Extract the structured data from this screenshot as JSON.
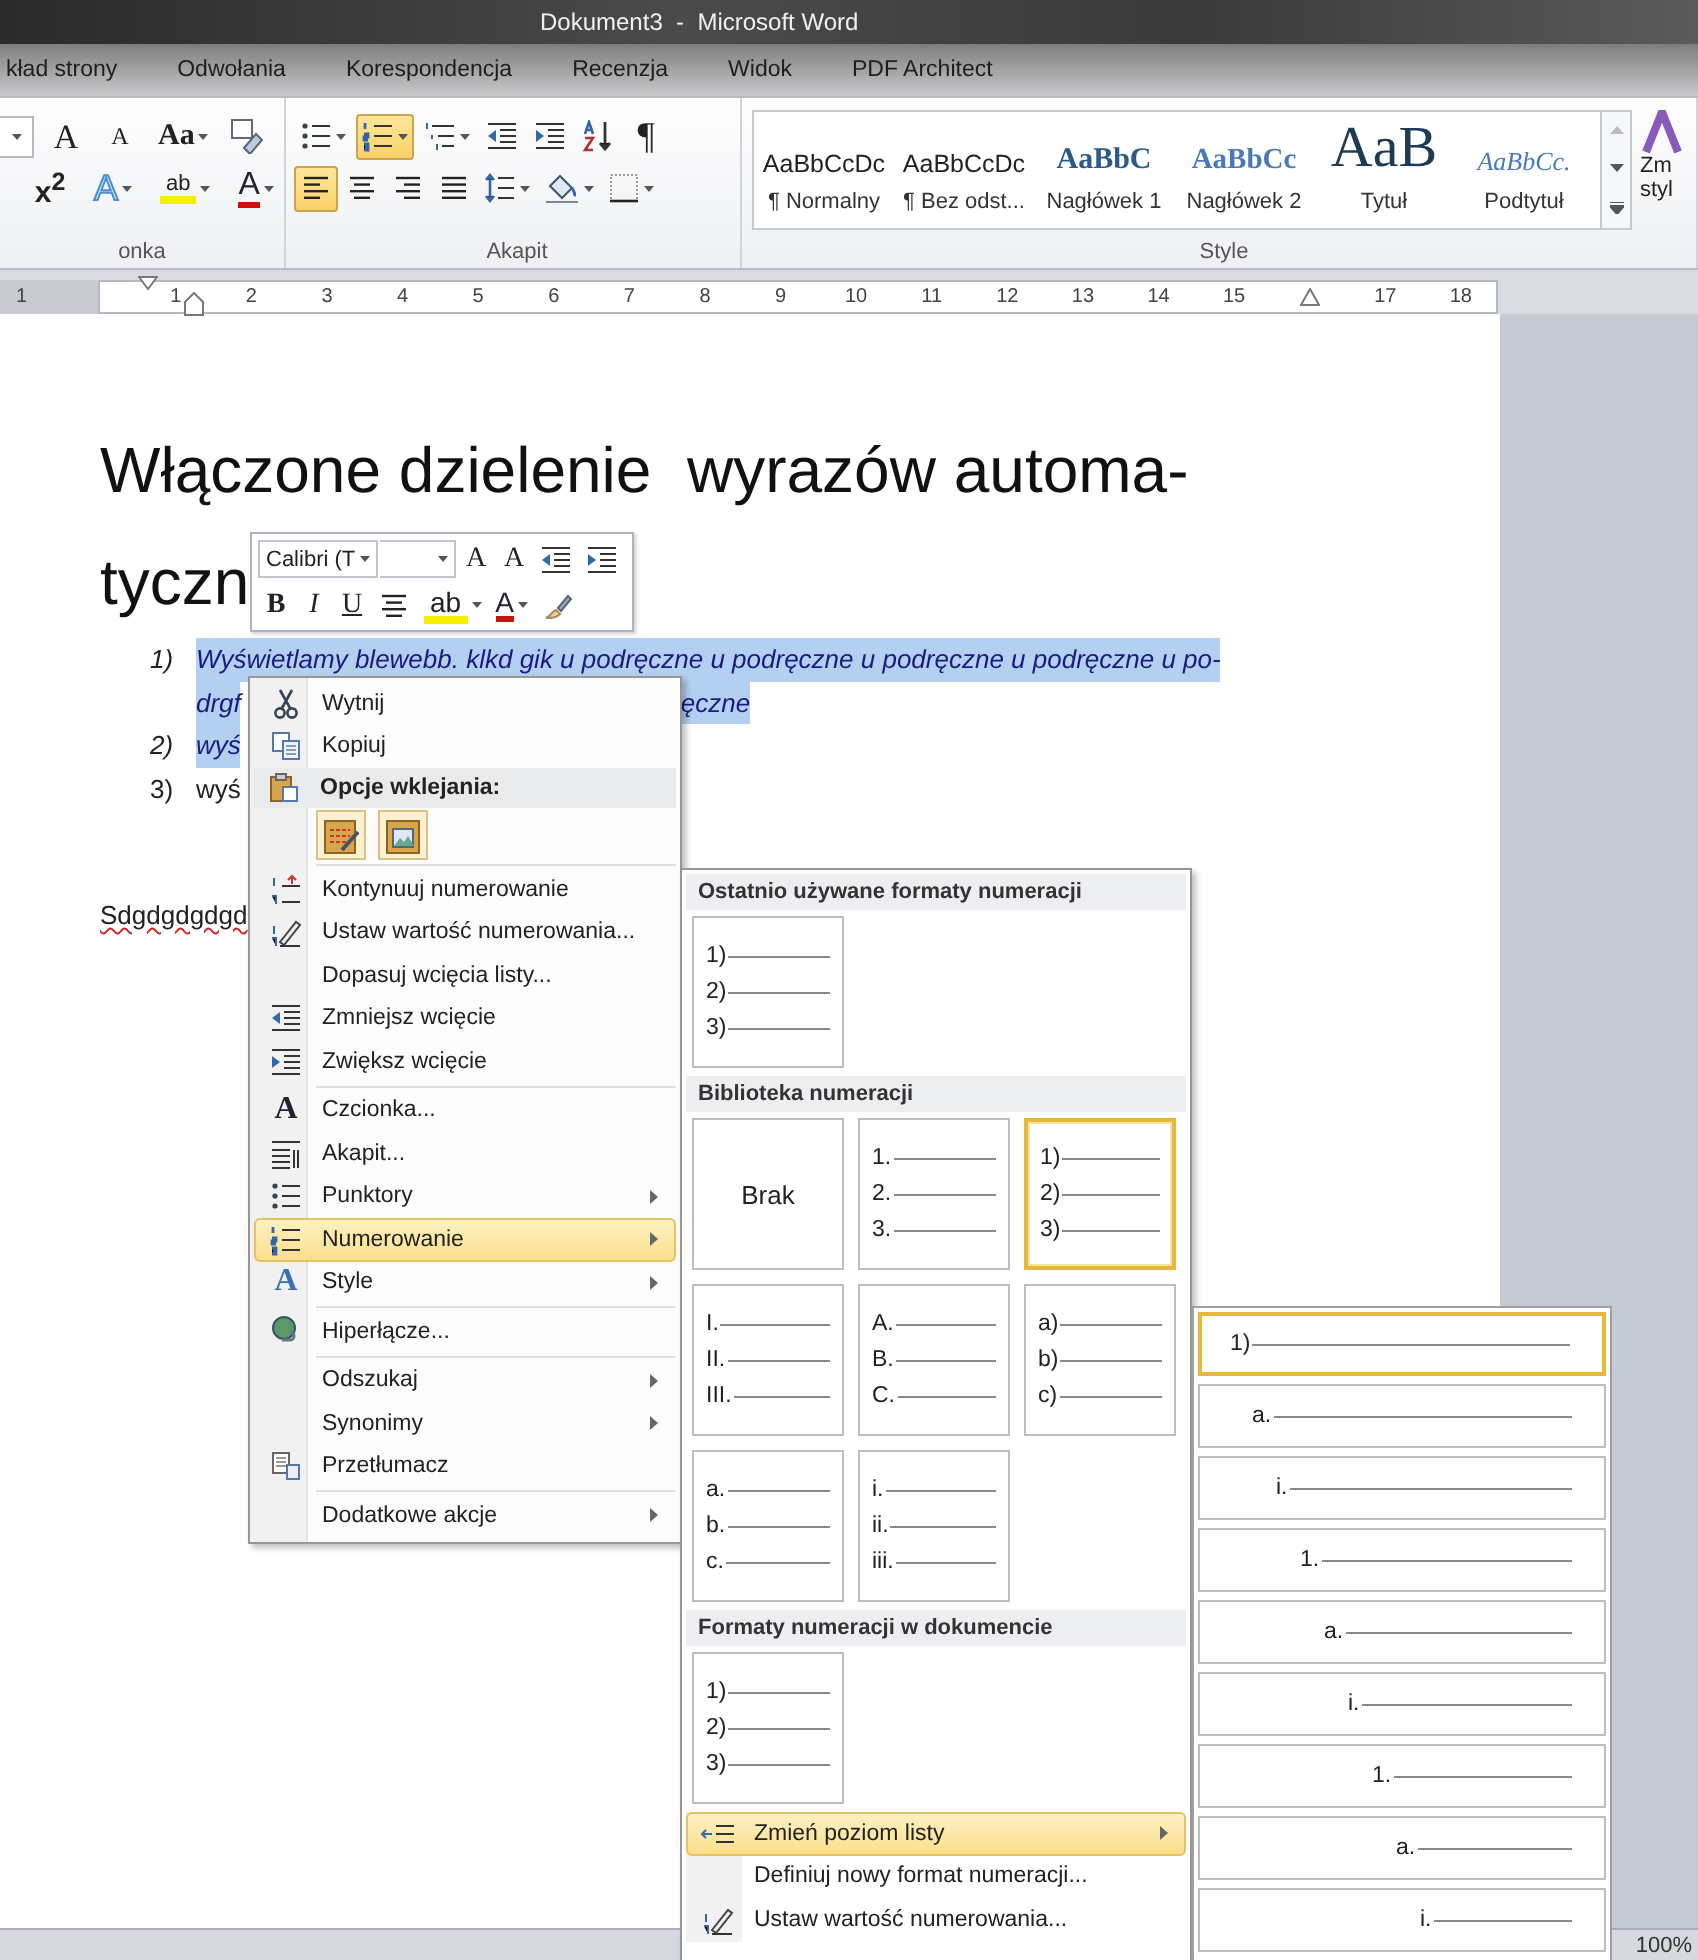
{
  "window": {
    "title": "Dokument3  -  Microsoft Word"
  },
  "tabs": [
    {
      "label": "kład strony",
      "selected": false
    },
    {
      "label": "Odwołania",
      "selected": false
    },
    {
      "label": "Korespondencja",
      "selected": false
    },
    {
      "label": "Recenzja",
      "selected": false
    },
    {
      "label": "Widok",
      "selected": false
    },
    {
      "label": "PDF Architect",
      "selected": false
    }
  ],
  "font_group": {
    "label": "onka",
    "row1": [
      {
        "kind": "size_dropdown"
      },
      {
        "kind": "grow",
        "glyph": "A"
      },
      {
        "kind": "shrink",
        "glyph": "A"
      },
      {
        "kind": "case",
        "glyph": "Aa"
      },
      {
        "kind": "clear"
      }
    ],
    "row2": [
      {
        "kind": "superscript",
        "glyph": "x$^{2}$"
      },
      {
        "kind": "effects",
        "glyph": "A"
      },
      {
        "kind": "highlight",
        "glyph": "ab"
      },
      {
        "kind": "color",
        "glyph": "A"
      }
    ]
  },
  "paragraph_group": {
    "label": "Akapit",
    "row1": [
      {
        "kind": "bullets",
        "selected": false
      },
      {
        "kind": "numbering",
        "selected": true
      },
      {
        "kind": "multilevel",
        "selected": false
      },
      {
        "kind": "outdent"
      },
      {
        "kind": "indent"
      },
      {
        "kind": "sort"
      },
      {
        "kind": "pilcrow",
        "glyph": "¶",
        "selected": false
      }
    ],
    "row2": [
      {
        "kind": "left",
        "selected": true
      },
      {
        "kind": "center",
        "selected": false
      },
      {
        "kind": "right",
        "selected": false
      },
      {
        "kind": "justify",
        "selected": false
      },
      {
        "kind": "spacing"
      },
      {
        "kind": "shading"
      },
      {
        "kind": "borders"
      }
    ]
  },
  "styles_group": {
    "label": "Style",
    "styles": [
      {
        "kind": "body",
        "sample": "AaBbCcDc",
        "label": "¶ Normalny"
      },
      {
        "kind": "body",
        "sample": "AaBbCcDc",
        "label": "¶ Bez odst..."
      },
      {
        "kind": "heading1",
        "sample": "AaBbC",
        "label": "Nagłówek 1"
      },
      {
        "kind": "heading2",
        "sample": "AaBbCc",
        "label": "Nagłówek 2"
      },
      {
        "kind": "title",
        "sample": "AaB",
        "label": "Tytuł"
      },
      {
        "kind": "subtitle",
        "sample": "AaBbCc.",
        "label": "Podtytuł"
      }
    ],
    "change_styles": [
      "Zm",
      "styl"
    ]
  },
  "ruler": {
    "left_labels": [
      "1"
    ],
    "labels": [
      "1",
      "2",
      "3",
      "4",
      "5",
      "6",
      "7",
      "8",
      "9",
      "10",
      "11",
      "12",
      "13",
      "14",
      "15",
      "17",
      "18"
    ]
  },
  "document": {
    "heading_lines": [
      "Włączone dzielenie  wyrazów automa-",
      "tyczn"
    ],
    "list": [
      {
        "number": "1)",
        "italic": true,
        "selected": true,
        "lines": [
          [
            "Wyświetlamy blewebb. klkd gik u podręczne u podręczne u podręczne u podręczne u po-"
          ],
          [
            "drgf",
            "ęczne"
          ]
        ]
      },
      {
        "number": "2)",
        "italic": true,
        "selected": true,
        "lines": [
          [
            "wyś"
          ]
        ]
      },
      {
        "number": "3)",
        "italic": false,
        "selected": false,
        "lines": [
          [
            "wyś"
          ]
        ]
      }
    ],
    "paragraph": "Sdgdgdgdgd"
  },
  "mini_toolbar": {
    "row1": [
      {
        "kind": "font_field",
        "value": "Calibri (T"
      },
      {
        "kind": "size_field"
      },
      {
        "kind": "grow",
        "glyph": "A"
      },
      {
        "kind": "shrink",
        "glyph": "A"
      },
      {
        "kind": "outdent"
      },
      {
        "kind": "indent"
      }
    ],
    "row2": [
      {
        "kind": "bold",
        "glyph": "B"
      },
      {
        "kind": "italic",
        "glyph": "I"
      },
      {
        "kind": "underline",
        "glyph": "U"
      },
      {
        "kind": "center",
        "selected": false
      },
      {
        "kind": "highlight",
        "glyph": "ab"
      },
      {
        "kind": "color",
        "glyph": "A"
      },
      {
        "kind": "painter"
      }
    ]
  },
  "context_menu": [
    {
      "kind": "item",
      "label": "Wytnij",
      "submenu": false,
      "selected": false
    },
    {
      "kind": "item",
      "label": "Kopiuj",
      "submenu": false,
      "selected": false
    },
    {
      "kind": "header",
      "label": "Opcje wklejania:"
    },
    {
      "kind": "paste_options"
    },
    {
      "kind": "separator"
    },
    {
      "kind": "item",
      "label": "Kontynuuj numerowanie",
      "submenu": false,
      "selected": false
    },
    {
      "kind": "item",
      "label": "Ustaw wartość numerowania...",
      "submenu": false,
      "selected": false
    },
    {
      "kind": "item",
      "label": "Dopasuj wcięcia listy...",
      "submenu": false,
      "selected": false
    },
    {
      "kind": "item",
      "label": "Zmniejsz wcięcie",
      "submenu": false,
      "selected": false
    },
    {
      "kind": "item",
      "label": "Zwiększ wcięcie",
      "submenu": false,
      "selected": false
    },
    {
      "kind": "separator"
    },
    {
      "kind": "item",
      "label": "Czcionka...",
      "glyph": "A",
      "submenu": false,
      "selected": false
    },
    {
      "kind": "item",
      "label": "Akapit...",
      "submenu": false,
      "selected": false
    },
    {
      "kind": "item",
      "label": "Punktory",
      "submenu": true,
      "selected": false
    },
    {
      "kind": "item",
      "label": "Numerowanie",
      "submenu": true,
      "selected": true
    },
    {
      "kind": "item",
      "label": "Style",
      "glyph": "A",
      "submenu": true,
      "selected": false
    },
    {
      "kind": "separator"
    },
    {
      "kind": "item",
      "label": "Hiperłącze...",
      "submenu": false,
      "selected": false
    },
    {
      "kind": "separator"
    },
    {
      "kind": "item",
      "label": "Odszukaj",
      "submenu": true,
      "selected": false
    },
    {
      "kind": "item",
      "label": "Synonimy",
      "submenu": true,
      "selected": false
    },
    {
      "kind": "item",
      "label": "Przetłumacz",
      "submenu": false,
      "selected": false
    },
    {
      "kind": "separator"
    },
    {
      "kind": "item",
      "label": "Dodatkowe akcje",
      "submenu": true,
      "selected": false
    }
  ],
  "numbering_gallery": {
    "sections": [
      {
        "title": "Ostatnio używane formaty numeracji",
        "tiles": [
          {
            "labels": [
              "1)",
              "2)",
              "3)"
            ],
            "selected": false
          }
        ]
      },
      {
        "title": "Biblioteka numeracji",
        "tiles": [
          {
            "text": "Brak",
            "selected": false
          },
          {
            "labels": [
              "1.",
              "2.",
              "3."
            ],
            "selected": false
          },
          {
            "labels": [
              "1)",
              "2)",
              "3)"
            ],
            "selected": true
          },
          {
            "labels": [
              "I.",
              "II.",
              "III."
            ],
            "selected": false
          },
          {
            "labels": [
              "A.",
              "B.",
              "C."
            ],
            "selected": false
          },
          {
            "labels": [
              "a)",
              "b)",
              "c)"
            ],
            "selected": false
          },
          {
            "labels": [
              "a.",
              "b.",
              "c."
            ],
            "selected": false
          },
          {
            "labels": [
              "i.",
              "ii.",
              "iii."
            ],
            "selected": false
          }
        ]
      },
      {
        "title": "Formaty numeracji w dokumencie",
        "tiles": [
          {
            "labels": [
              "1)",
              "2)",
              "3)"
            ],
            "selected": false
          }
        ]
      }
    ],
    "actions": [
      {
        "label": "Zmień poziom listy",
        "submenu": true,
        "selected": true
      },
      {
        "label": "Definiuj nowy format numeracji...",
        "submenu": false,
        "selected": false
      },
      {
        "label": "Ustaw wartość numerowania...",
        "submenu": false,
        "selected": false
      }
    ]
  },
  "list_levels": [
    {
      "label": "1)",
      "selected": true
    },
    {
      "label": "a.",
      "selected": false
    },
    {
      "label": "i.",
      "selected": false
    },
    {
      "label": "1.",
      "selected": false
    },
    {
      "label": "a.",
      "selected": false
    },
    {
      "label": "i.",
      "selected": false
    },
    {
      "label": "1.",
      "selected": false
    },
    {
      "label": "a.",
      "selected": false
    },
    {
      "label": "i.",
      "selected": false
    }
  ],
  "status_bar": {
    "zoom": "100%"
  }
}
